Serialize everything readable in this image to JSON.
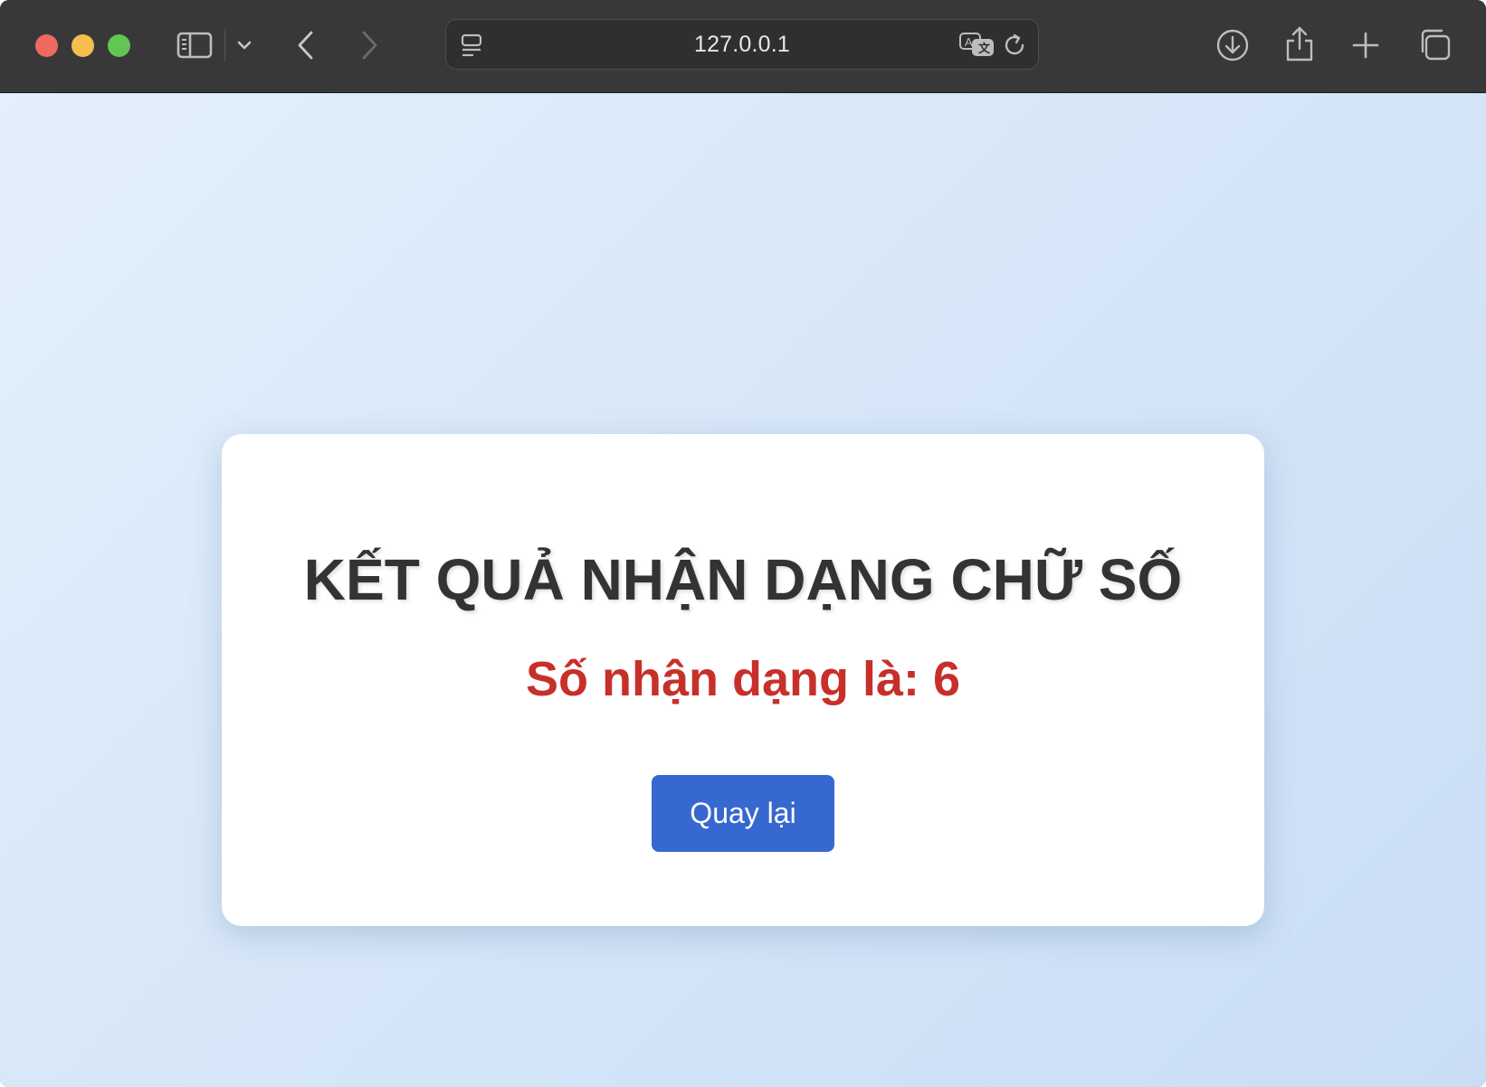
{
  "browser": {
    "url": "127.0.0.1",
    "icons": {
      "sidebar": "sidebar-icon",
      "tab_group_menu": "chevron-down-icon",
      "back": "chevron-left-icon",
      "forward": "chevron-right-icon",
      "page_menu": "page-menu-icon",
      "translate": "translate-icon",
      "reload": "reload-icon",
      "download": "download-icon",
      "share": "share-icon",
      "new_tab": "plus-icon",
      "tab_overview": "tabs-overview-icon"
    }
  },
  "page": {
    "title": "KẾT QUẢ NHẬN DẠNG CHỮ SỐ",
    "result_text": "Số nhận dạng là: 6",
    "back_button_label": "Quay lại"
  },
  "colors": {
    "title": "#333333",
    "result": "#c7302a",
    "button": "#3768d0",
    "background": "#d7e7f8"
  }
}
